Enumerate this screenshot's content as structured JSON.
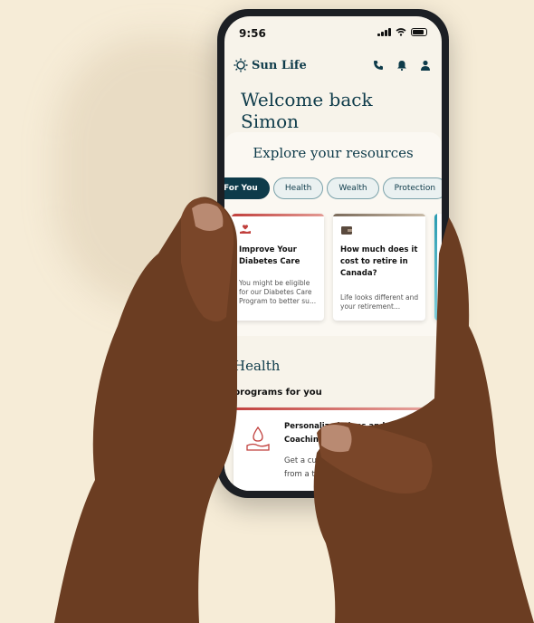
{
  "status": {
    "time": "9:56"
  },
  "header": {
    "brand": "Sun Life",
    "welcome": "Welcome back Simon"
  },
  "explore": {
    "title": "Explore your resources",
    "tabs": [
      "For You",
      "Health",
      "Wealth",
      "Protection"
    ],
    "active_tab": "For You"
  },
  "cards": [
    {
      "title": "Improve Your Diabetes Care",
      "desc": "You might be eligible for our Diabetes Care Program to better su...",
      "icon": "hand-heart-icon",
      "accent": "#c1403d"
    },
    {
      "title": "How much does it cost to retire in Canada?",
      "desc": "Life looks different and your retirement...",
      "icon": "wallet-icon",
      "accent": "#7a6a5a"
    }
  ],
  "health": {
    "title": "Health",
    "subtitle": "programs for you",
    "program": {
      "title": "Personalized Plans and Coaching for Diabetes",
      "desc": "Get a custom plan, medical support from a team pharmacists"
    }
  },
  "colors": {
    "brand": "#0e3b4a",
    "accent_red": "#c1403d",
    "background": "#f6ecd7"
  }
}
